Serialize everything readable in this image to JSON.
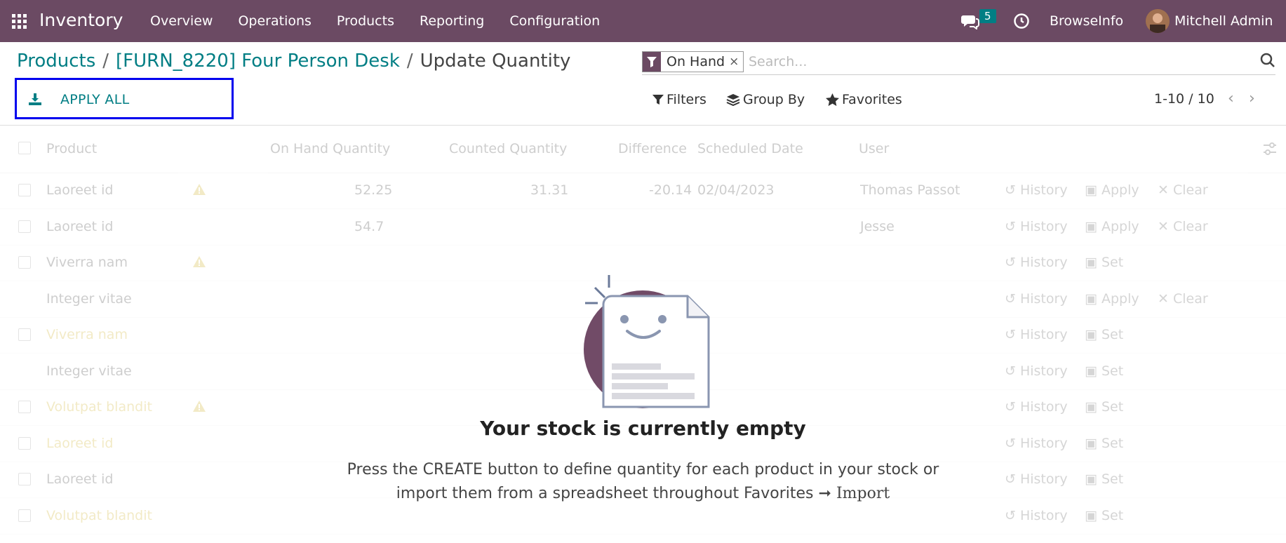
{
  "topbar": {
    "app_name": "Inventory",
    "menu": [
      "Overview",
      "Operations",
      "Products",
      "Reporting",
      "Configuration"
    ],
    "chat_count": "5",
    "company": "BrowseInfo",
    "user": "Mitchell Admin",
    "bar_color": "#6b4a63"
  },
  "breadcrumb": {
    "items": [
      "Products",
      "[FURN_8220] Four Person Desk"
    ],
    "current": "Update Quantity",
    "sep": "/"
  },
  "toolbar": {
    "apply_all": "APPLY ALL"
  },
  "search": {
    "facet": "On Hand",
    "facet_remove": "×",
    "placeholder": "Search..."
  },
  "controls": {
    "filters": "Filters",
    "group_by": "Group By",
    "favorites": "Favorites"
  },
  "pager": {
    "range": "1-10 / 10"
  },
  "table": {
    "columns": [
      "Product",
      "On Hand Quantity",
      "Counted Quantity",
      "Difference",
      "Scheduled Date",
      "User"
    ],
    "rows": [
      {
        "product": "Laoreet id",
        "on_hand": "52.25",
        "counted": "31.31",
        "diff": "-20.14",
        "date": "02/04/2023",
        "user": "Thomas Passot",
        "a1": "History",
        "a2": "Apply",
        "a3": "Clear",
        "warn": true
      },
      {
        "product": "Laoreet id",
        "on_hand": "54.7",
        "counted": "",
        "diff": "",
        "date": "",
        "user": "Jesse",
        "a1": "History",
        "a2": "Apply",
        "a3": "Clear",
        "warn": false
      },
      {
        "product": "Viverra nam",
        "on_hand": "",
        "counted": "",
        "diff": "",
        "date": "",
        "user": "",
        "a1": "History",
        "a2": "Set",
        "a3": "",
        "warn": true
      },
      {
        "product": "Integer vitae",
        "on_hand": "",
        "counted": "",
        "diff": "",
        "date": "",
        "user": "",
        "a1": "History",
        "a2": "Apply",
        "a3": "Clear",
        "warn": false
      },
      {
        "product": "Viverra nam",
        "on_hand": "",
        "counted": "",
        "diff": "",
        "date": "",
        "user": "",
        "a1": "History",
        "a2": "Set",
        "a3": "",
        "warn": false
      },
      {
        "product": "Integer vitae",
        "on_hand": "",
        "counted": "",
        "diff": "",
        "date": "",
        "user": "",
        "a1": "History",
        "a2": "Set",
        "a3": "",
        "warn": false
      },
      {
        "product": "Volutpat blandit",
        "on_hand": "",
        "counted": "",
        "diff": "",
        "date": "",
        "user": "",
        "a1": "History",
        "a2": "Set",
        "a3": "",
        "warn": true
      },
      {
        "product": "Laoreet id",
        "on_hand": "",
        "counted": "",
        "diff": "",
        "date": "",
        "user": "",
        "a1": "History",
        "a2": "Set",
        "a3": "",
        "warn": false
      },
      {
        "product": "Laoreet id",
        "on_hand": "",
        "counted": "",
        "diff": "",
        "date": "",
        "user": "",
        "a1": "History",
        "a2": "Set",
        "a3": "",
        "warn": false
      },
      {
        "product": "Volutpat blandit",
        "on_hand": "",
        "counted": "",
        "diff": "",
        "date": "",
        "user": "",
        "a1": "History",
        "a2": "Set",
        "a3": "",
        "warn": false
      }
    ]
  },
  "empty_state": {
    "title": "Your stock is currently empty",
    "line1": "Press the CREATE button to define quantity for each product in your stock or",
    "line2_pre": "import them from a spreadsheet throughout Favorites",
    "arrow": "➞",
    "line2_post": "Import"
  }
}
